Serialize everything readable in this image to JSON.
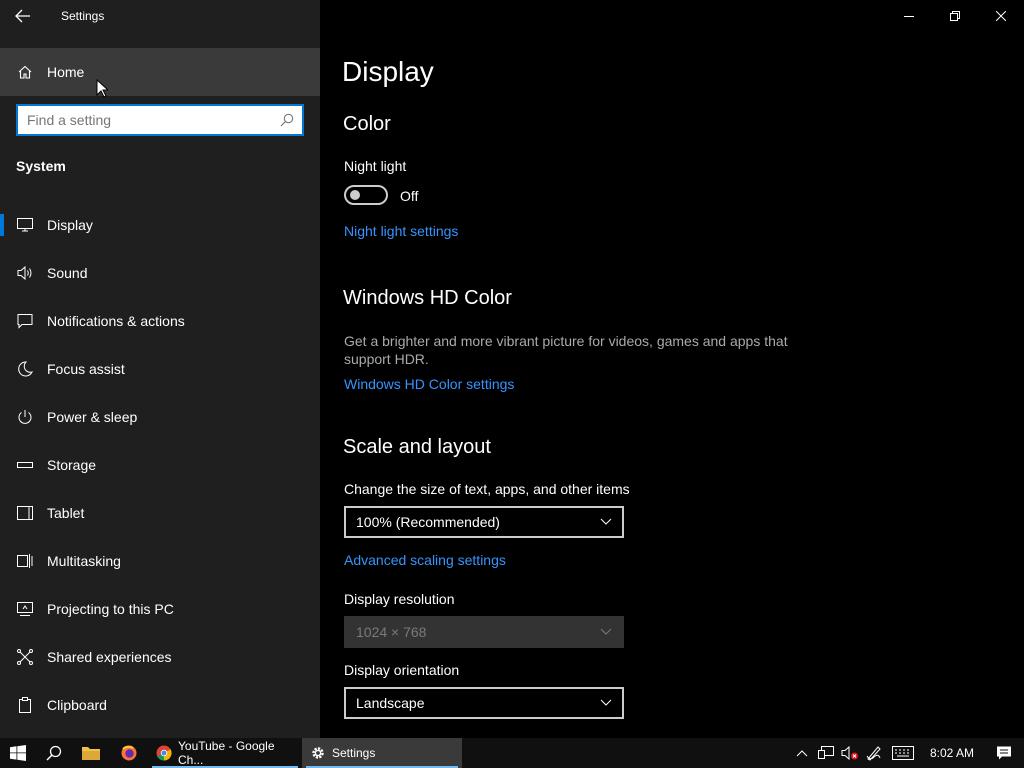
{
  "window": {
    "title": "Settings"
  },
  "sidebar": {
    "home_label": "Home",
    "search_placeholder": "Find a setting",
    "section_title": "System",
    "items": [
      {
        "label": "Display",
        "icon": "monitor-icon"
      },
      {
        "label": "Sound",
        "icon": "speaker-icon"
      },
      {
        "label": "Notifications & actions",
        "icon": "notification-icon"
      },
      {
        "label": "Focus assist",
        "icon": "moon-icon"
      },
      {
        "label": "Power & sleep",
        "icon": "power-icon"
      },
      {
        "label": "Storage",
        "icon": "storage-icon"
      },
      {
        "label": "Tablet",
        "icon": "tablet-icon"
      },
      {
        "label": "Multitasking",
        "icon": "multitasking-icon"
      },
      {
        "label": "Projecting to this PC",
        "icon": "projecting-icon"
      },
      {
        "label": "Shared experiences",
        "icon": "shared-icon"
      },
      {
        "label": "Clipboard",
        "icon": "clipboard-icon"
      }
    ]
  },
  "main": {
    "page_title": "Display",
    "color": {
      "heading": "Color",
      "night_light_label": "Night light",
      "night_light_state": "Off",
      "night_light_link": "Night light settings"
    },
    "hdr": {
      "heading": "Windows HD Color",
      "description": "Get a brighter and more vibrant picture for videos, games and apps that support HDR.",
      "link": "Windows HD Color settings"
    },
    "scale": {
      "heading": "Scale and layout",
      "size_label": "Change the size of text, apps, and other items",
      "size_value": "100% (Recommended)",
      "advanced_link": "Advanced scaling settings",
      "resolution_label": "Display resolution",
      "resolution_value": "1024 × 768",
      "orientation_label": "Display orientation",
      "orientation_value": "Landscape"
    }
  },
  "taskbar": {
    "apps": [
      {
        "label": "YouTube - Google Ch...",
        "icon": "chrome-icon"
      },
      {
        "label": "Settings",
        "icon": "gear-icon"
      }
    ],
    "clock": "8:02 AM"
  },
  "colors": {
    "accent": "#0078d7",
    "link": "#3794ff",
    "sidebar_bg": "#1f1f1f",
    "hover_bg": "#3a3a3a"
  }
}
